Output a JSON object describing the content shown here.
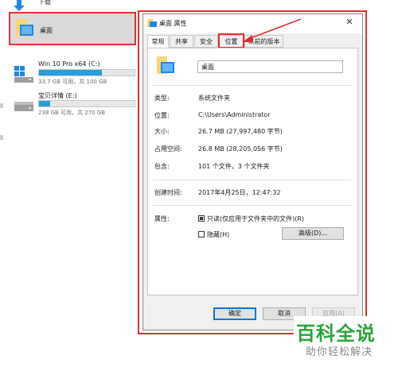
{
  "explorer": {
    "download_label": "下载",
    "desktop_label": "桌面",
    "drives": [
      {
        "name": "Win 10 Pro x64 (C:)",
        "size": "33.7 GB 可用，共 100 GB",
        "used_fraction": 0.66
      },
      {
        "name": "宝贝详情 (E:)",
        "size": "238 GB 可用，共 270 GB",
        "used_fraction": 0.12
      }
    ]
  },
  "dialog": {
    "title": "桌面 属性",
    "close": "✕",
    "tabs": [
      "常规",
      "共享",
      "安全",
      "位置",
      "以前的版本"
    ],
    "active_tab": "常规",
    "highlighted_tab": "位置",
    "name_value": "桌面",
    "props": [
      {
        "label": "类型:",
        "value": "系统文件夹"
      },
      {
        "label": "位置:",
        "value": "C:\\Users\\Administrator"
      },
      {
        "label": "大小:",
        "value": "26.7 MB (27,997,480 字节)"
      },
      {
        "label": "占用空间:",
        "value": "26.8 MB (28,205,056 字节)"
      },
      {
        "label": "包含:",
        "value": "101 个文件，3 个文件夹"
      },
      {
        "label": "创建时间:",
        "value": "2017年4月25日，12:47:32"
      }
    ],
    "attributes_label": "属性:",
    "readonly_label": "只读(仅应用于文件夹中的文件)(R)",
    "hidden_label": "隐藏(H)",
    "advanced_button": "高级(D)...",
    "ok_button": "确定",
    "cancel_button": "取消",
    "apply_button": "应用(A)"
  },
  "watermark": {
    "main": "百科全说",
    "sub": "助你轻松解决"
  },
  "colors": {
    "accent": "#0078d7",
    "highlight_red": "#e0302f",
    "progress_blue": "#26a0da",
    "watermark_green": "#2aa43a"
  }
}
